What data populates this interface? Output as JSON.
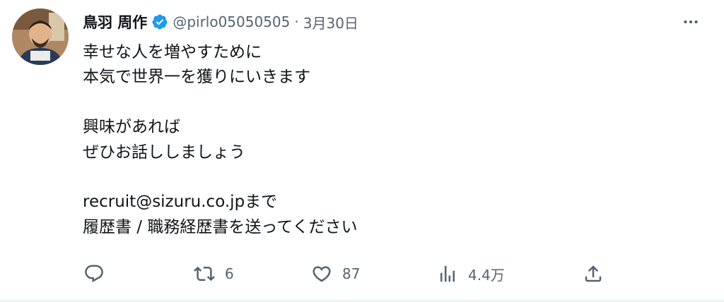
{
  "user": {
    "display_name": "鳥羽 周作",
    "handle": "@pirlo05050505",
    "separator": "·",
    "date": "3月30日",
    "verified_icon": "verified-badge-icon",
    "verified_color": "#1d9bf0"
  },
  "tweet_lines": [
    "幸せな人を増やすために",
    "本気で世界一を獲りにいきます",
    "",
    "興味があれば",
    "ぜひお話ししましょう",
    "",
    "recruit@sizuru.co.jpまで",
    "履歴書 / 職務経歴書を送ってください"
  ],
  "actions": {
    "reply": {
      "icon": "reply-icon",
      "count": ""
    },
    "retweet": {
      "icon": "retweet-icon",
      "count": "6"
    },
    "like": {
      "icon": "heart-icon",
      "count": "87"
    },
    "views": {
      "icon": "analytics-icon",
      "count": "4.4万"
    },
    "share": {
      "icon": "share-icon"
    }
  },
  "more_icon": "more-icon",
  "colors": {
    "text": "#0f1419",
    "secondary": "#536471",
    "accent": "#1d9bf0"
  }
}
